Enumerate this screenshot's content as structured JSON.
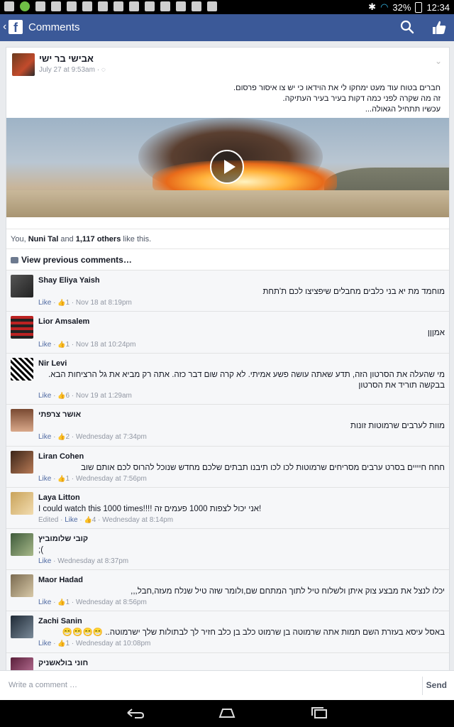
{
  "status_bar": {
    "battery": "32%",
    "time": "12:34"
  },
  "app_bar": {
    "title": "Comments"
  },
  "post": {
    "author": "אבישי בר ישי",
    "date": "July 27 at 9:53am",
    "text_lines": [
      "חברים בטוח עוד מעט ימחקו לי את הוידאו כי יש צו איסור פרסום.",
      "זה מה שקרה לפני כמה דקות בעיר בעיר העתיקה.",
      "עכשיו תתחיל הגאולה..."
    ]
  },
  "likes": {
    "prefix": "You, ",
    "name": "Nuni Tal",
    "mid": " and ",
    "count": "1,117 others",
    "suffix": " like this."
  },
  "view_previous": "View previous comments…",
  "comments": [
    {
      "name": "Shay Eliya Yaish",
      "text": "מוחמד מת יא בני כלבים מחבלים שיפציצו לכם ת'תחת",
      "meta_pre": "",
      "like": "Like",
      "likes": "1",
      "time": "Nov 18 at 8:19pm"
    },
    {
      "name": "Lior Amsalem",
      "text": "אמןןן",
      "meta_pre": "",
      "like": "Like",
      "likes": "1",
      "time": "Nov 18 at 10:24pm"
    },
    {
      "name": "Nir Levi",
      "text": "מי שהעלה את הסרטון הזה, תדע שאתה עושה פשע אמיתי. לא קרה שום דבר כזה. אתה רק מביא את גל הרציחות הבא. בבקשה תוריד את הסרטון",
      "meta_pre": "",
      "like": "Like",
      "likes": "6",
      "time": "Nov 19 at 1:29am"
    },
    {
      "name": "אושר צרפתי",
      "text": "מוות לערבים שרמוטות זונות",
      "meta_pre": "",
      "like": "Like",
      "likes": "2",
      "time": "Wednesday at 7:34pm"
    },
    {
      "name": "Liran Cohen",
      "text": "חחח חיייים בסרט ערבים מסריחים שרמוטות לכו לכו תיבנו תבתים שלכם מחדש שנוכל להרוס לכם אותם שוב",
      "meta_pre": "",
      "like": "Like",
      "likes": "1",
      "time": "Wednesday at 7:56pm"
    },
    {
      "name": "Laya Litton",
      "text": "I could watch this 1000 times!!!! אני יכול לצפות 1000 פעמים זה!",
      "meta_pre": "Edited · ",
      "like": "Like",
      "likes": "4",
      "time": "Wednesday at 8:14pm"
    },
    {
      "name": "קובי שלומוביץ",
      "text": ";(",
      "meta_pre": "",
      "like": "Like",
      "likes": "",
      "time": "Wednesday at 8:37pm"
    },
    {
      "name": "Maor Hadad",
      "text": "יכלו לנצל את מבצע צוק איתן ולשלוח טיל לתוך המתחם שם,ולומר שזה טיל שנלח מעזה,חבל,,,",
      "meta_pre": "",
      "like": "Like",
      "likes": "1",
      "time": "Wednesday at 8:56pm"
    },
    {
      "name": "Zachi Sanin",
      "text": "באסל עיסא בעזרת השם תמות אתה שרמוטה בן שרמוט כלב בן כלב חזיר לך לבתולות שלך ישרמוטה.. 😁😁😁😁",
      "meta_pre": "",
      "like": "Like",
      "likes": "1",
      "time": "Wednesday at 10:08pm"
    },
    {
      "name": "חוני בולאשניק",
      "text": "",
      "meta_pre": "",
      "like": "",
      "likes": "",
      "time": ""
    }
  ],
  "composer": {
    "placeholder": "Write a comment …",
    "send": "Send"
  },
  "colors": {
    "brand": "#3b5998",
    "link": "#4e69a2"
  }
}
